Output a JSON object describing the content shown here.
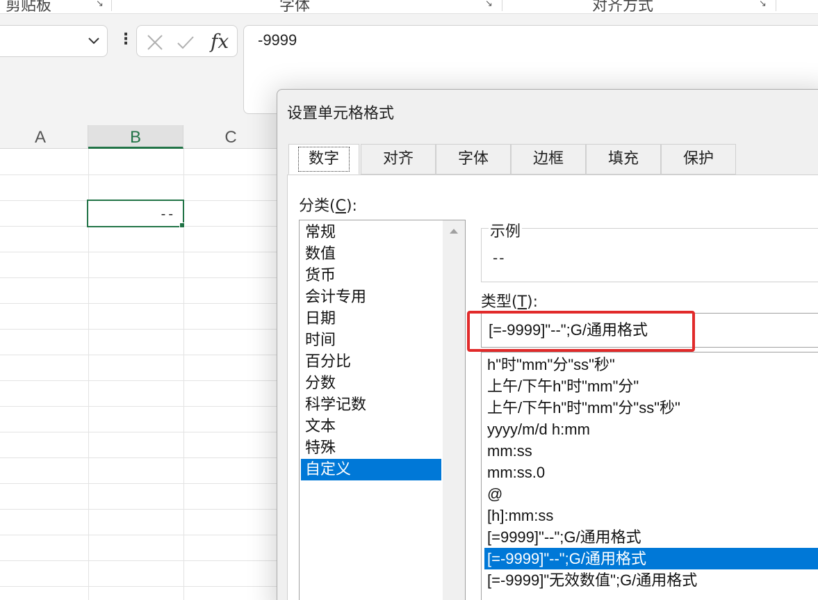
{
  "ribbon": {
    "groups": [
      {
        "label": "剪贴板"
      },
      {
        "label": "字体"
      },
      {
        "label": "对齐方式"
      }
    ]
  },
  "formula_bar": {
    "name_box_value": "",
    "fx_label": "fx",
    "formula_value": "-9999"
  },
  "grid": {
    "columns": [
      "A",
      "B",
      "C"
    ],
    "active_column": "B",
    "active_cell_value": "--"
  },
  "dialog": {
    "title": "设置单元格格式",
    "tabs": [
      "数字",
      "对齐",
      "字体",
      "边框",
      "填充",
      "保护"
    ],
    "active_tab": "数字",
    "category_label": "分类(",
    "category_accel": "C",
    "category_label_end": "):",
    "categories": [
      "常规",
      "数值",
      "货币",
      "会计专用",
      "日期",
      "时间",
      "百分比",
      "分数",
      "科学记数",
      "文本",
      "特殊",
      "自定义"
    ],
    "selected_category": "自定义",
    "sample_label": "示例",
    "sample_value": "--",
    "type_label": "类型(",
    "type_accel": "T",
    "type_label_end": "):",
    "type_input_value": "[=-9999]\"--\";G/通用格式",
    "type_items": [
      "h\"时\"mm\"分\"ss\"秒\"",
      "上午/下午h\"时\"mm\"分\"",
      "上午/下午h\"时\"mm\"分\"ss\"秒\"",
      "yyyy/m/d h:mm",
      "mm:ss",
      "mm:ss.0",
      "@",
      "[h]:mm:ss",
      "[=9999]\"--\";G/通用格式",
      "[=-9999]\"--\";G/通用格式",
      "[=-9999]\"无效数值\";G/通用格式"
    ],
    "selected_type_index": 9
  },
  "colors": {
    "excel_green": "#217346",
    "selection_blue": "#0078d7",
    "highlight_red": "#e12a2a"
  }
}
